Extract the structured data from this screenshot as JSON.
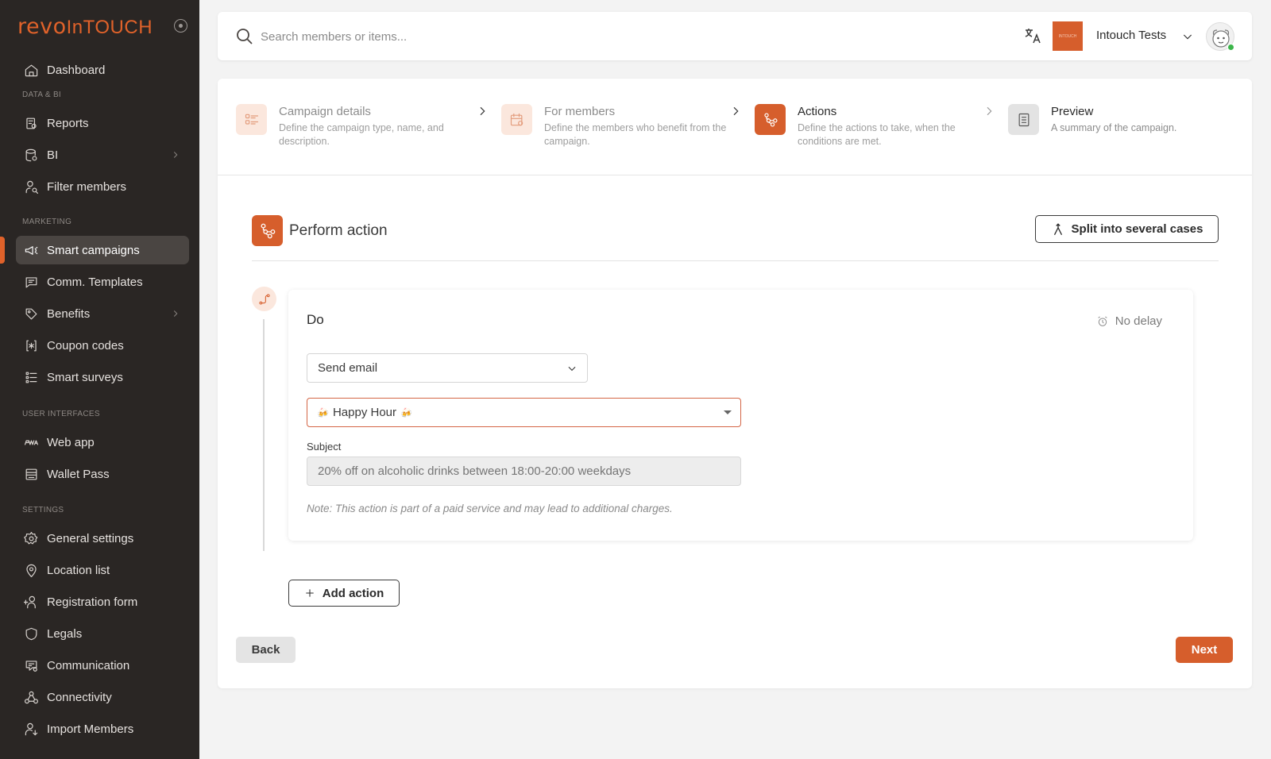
{
  "brand": {
    "part1": "revo",
    "part2": "InTOUCH"
  },
  "sidebar": {
    "sections": {
      "data_bi": "DATA & BI",
      "marketing": "MARKETING",
      "user_interfaces": "USER INTERFACES",
      "settings": "SETTINGS"
    },
    "items": [
      {
        "label": "Dashboard",
        "icon": "home-icon"
      },
      {
        "label": "Reports",
        "icon": "report-icon"
      },
      {
        "label": "BI",
        "icon": "database-icon"
      },
      {
        "label": "Filter members",
        "icon": "user-search-icon"
      },
      {
        "label": "Smart campaigns",
        "icon": "megaphone-icon"
      },
      {
        "label": "Comm. Templates",
        "icon": "message-icon"
      },
      {
        "label": "Benefits",
        "icon": "tag-icon"
      },
      {
        "label": "Coupon codes",
        "icon": "coupon-icon"
      },
      {
        "label": "Smart surveys",
        "icon": "list-icon"
      },
      {
        "label": "Web app",
        "icon": "pwa-icon"
      },
      {
        "label": "Wallet Pass",
        "icon": "wallet-icon"
      },
      {
        "label": "General settings",
        "icon": "gear-icon"
      },
      {
        "label": "Location list",
        "icon": "pin-icon"
      },
      {
        "label": "Registration form",
        "icon": "user-plus-icon"
      },
      {
        "label": "Legals",
        "icon": "shield-icon"
      },
      {
        "label": "Communication",
        "icon": "chat-settings-icon"
      },
      {
        "label": "Connectivity",
        "icon": "connectivity-icon"
      },
      {
        "label": "Import Members",
        "icon": "user-import-icon"
      }
    ]
  },
  "topbar": {
    "search_placeholder": "Search members or items...",
    "org_name": "Intouch Tests",
    "org_logo_text": "INTOUCH"
  },
  "steps": [
    {
      "title": "Campaign details",
      "desc": "Define the campaign type, name, and description.",
      "state": "done"
    },
    {
      "title": "For members",
      "desc": "Define the members who benefit from the campaign.",
      "state": "done"
    },
    {
      "title": "Actions",
      "desc": "Define the actions to take, when the conditions are met.",
      "state": "current"
    },
    {
      "title": "Preview",
      "desc": "A summary of the campaign.",
      "state": "todo"
    }
  ],
  "section": {
    "title": "Perform action",
    "split_label": "Split into several cases"
  },
  "action": {
    "do_label": "Do",
    "delay_label": "No delay",
    "action_type": "Send email",
    "template": "Happy Hour",
    "template_glyph": "🍻",
    "subject_label": "Subject",
    "subject_placeholder": "20% off on alcoholic drinks between 18:00-20:00 weekdays",
    "note": "Note: This action is part of a paid service and may lead to additional charges."
  },
  "buttons": {
    "add_action": "Add action",
    "back": "Back",
    "next": "Next"
  },
  "colors": {
    "accent": "#d65e2c",
    "sidebar_bg": "#2a2624",
    "sidebar_active": "#4a4542",
    "status_online": "#3bb54a"
  }
}
